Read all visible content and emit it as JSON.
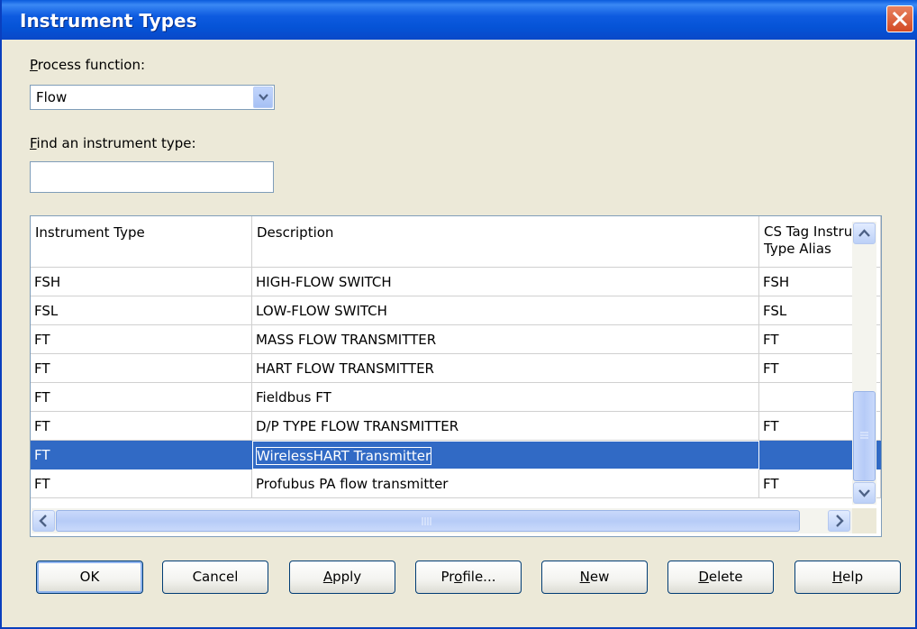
{
  "window": {
    "title": "Instrument Types"
  },
  "process_function": {
    "label_prefix": "",
    "label_mnemonic": "P",
    "label_rest": "rocess function:",
    "selected": "Flow"
  },
  "find": {
    "label_mnemonic": "F",
    "label_rest": "ind an instrument type:",
    "value": ""
  },
  "grid": {
    "columns": [
      {
        "header": "Instrument Type"
      },
      {
        "header": "Description"
      },
      {
        "header_line1": "CS Tag Instrume",
        "header_line2": "Type Alias"
      }
    ],
    "rows": [
      {
        "type": "FSH",
        "description": "HIGH-FLOW SWITCH",
        "alias": "FSH"
      },
      {
        "type": "FSL",
        "description": "LOW-FLOW SWITCH",
        "alias": "FSL"
      },
      {
        "type": "FT",
        "description": "MASS FLOW TRANSMITTER",
        "alias": "FT"
      },
      {
        "type": "FT",
        "description": "HART FLOW TRANSMITTER",
        "alias": "FT"
      },
      {
        "type": "FT",
        "description": "Fieldbus FT",
        "alias": ""
      },
      {
        "type": "FT",
        "description": "D/P TYPE FLOW TRANSMITTER",
        "alias": "FT"
      },
      {
        "type": "FT",
        "description": "WirelessHART Transmitter",
        "alias": "",
        "selected": true
      },
      {
        "type": "FT",
        "description": "Profubus PA flow transmitter",
        "alias": "FT"
      }
    ]
  },
  "buttons": {
    "ok": "OK",
    "cancel": "Cancel",
    "apply_m": "A",
    "apply_r": "pply",
    "profile_a": "Pr",
    "profile_m": "o",
    "profile_r": "file...",
    "new_m": "N",
    "new_r": "ew",
    "delete_m": "D",
    "delete_r": "elete",
    "help_m": "H",
    "help_r": "elp"
  },
  "colors": {
    "titlebar": "#0553d6",
    "selection": "#316ac5",
    "dialog_bg": "#ece9d8"
  },
  "icons": {
    "close": "close-icon",
    "dropdown": "chevron-down-icon"
  }
}
